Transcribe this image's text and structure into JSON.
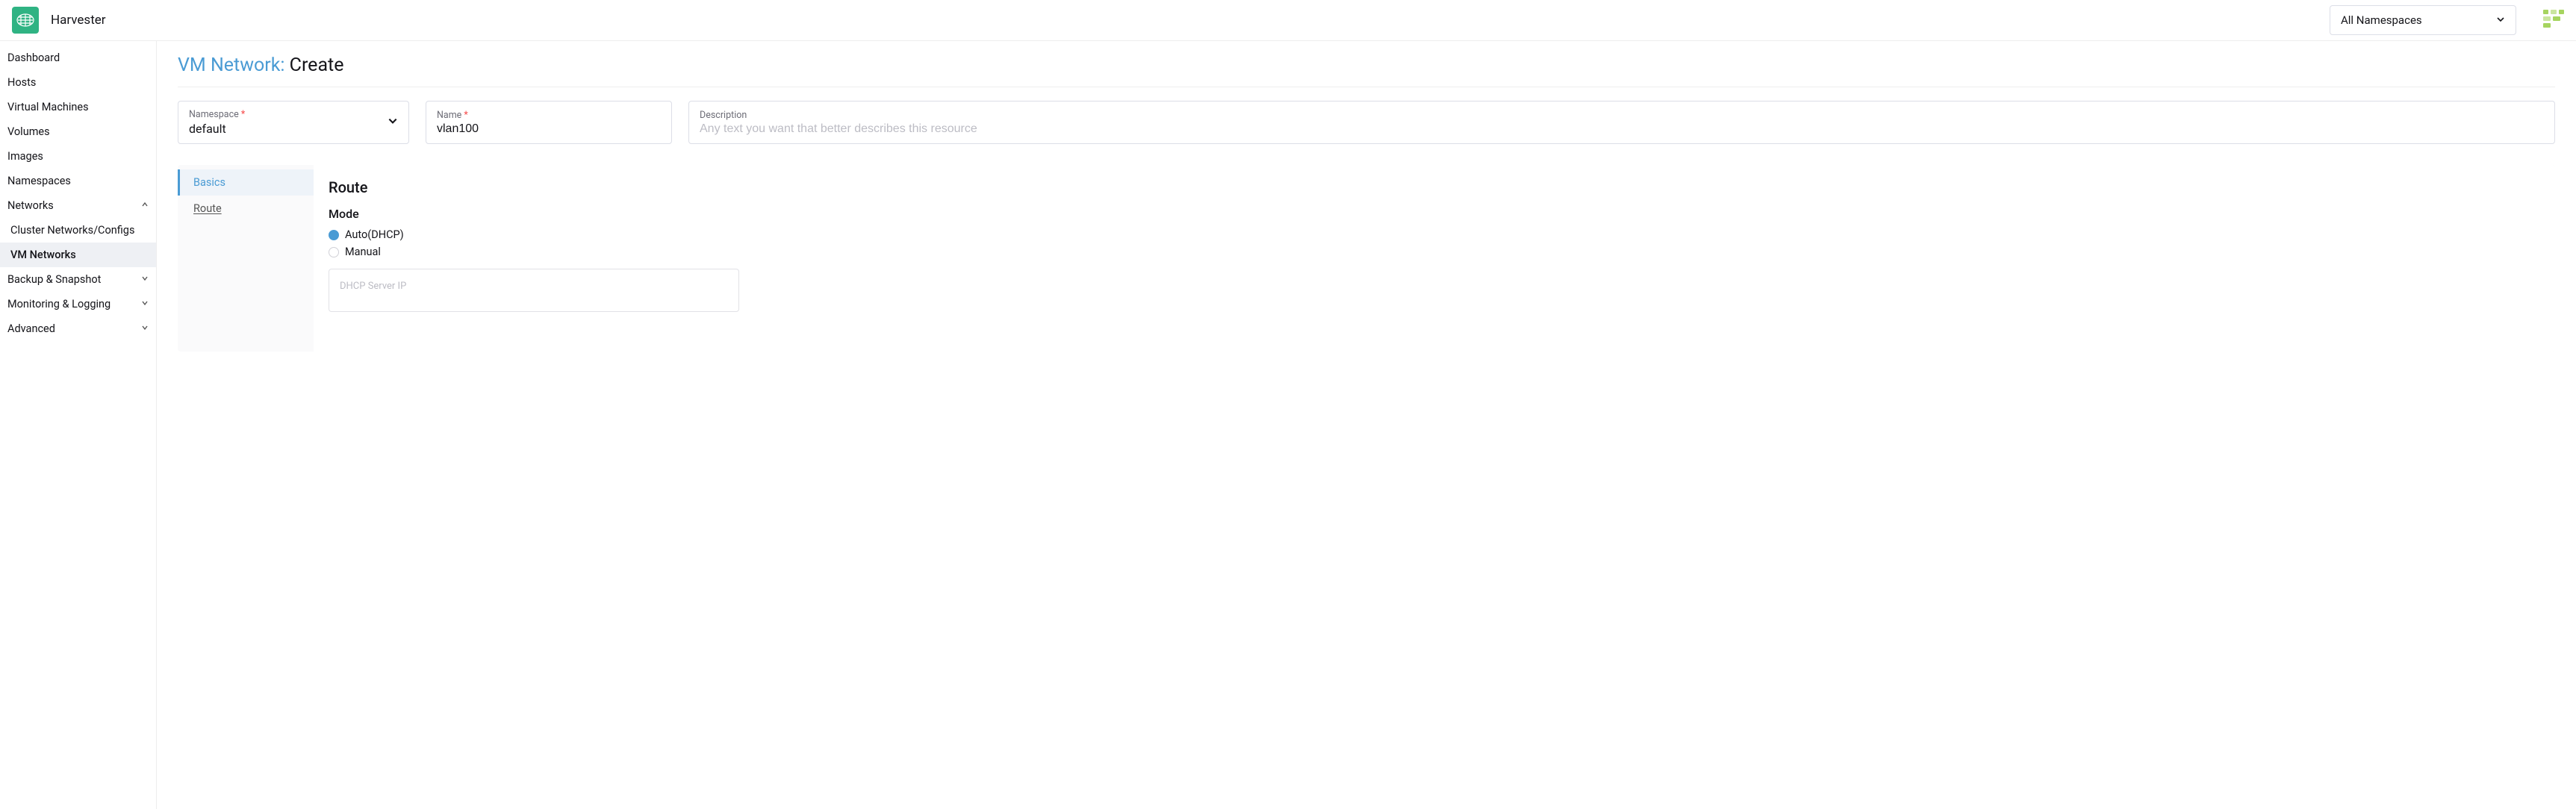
{
  "header": {
    "brand": "Harvester",
    "namespace_selector": "All Namespaces"
  },
  "sidebar": {
    "items": [
      {
        "label": "Dashboard"
      },
      {
        "label": "Hosts"
      },
      {
        "label": "Virtual Machines"
      },
      {
        "label": "Volumes"
      },
      {
        "label": "Images"
      },
      {
        "label": "Namespaces"
      },
      {
        "label": "Networks",
        "expandable": true,
        "expanded": true,
        "children": [
          {
            "label": "Cluster Networks/Configs"
          },
          {
            "label": "VM Networks",
            "active": true
          }
        ]
      },
      {
        "label": "Backup & Snapshot",
        "expandable": true,
        "expanded": false
      },
      {
        "label": "Monitoring & Logging",
        "expandable": true,
        "expanded": false
      },
      {
        "label": "Advanced",
        "expandable": true,
        "expanded": false
      }
    ]
  },
  "page": {
    "title_type": "VM Network:",
    "title_action": "Create"
  },
  "form": {
    "namespace": {
      "label": "Namespace",
      "required": true,
      "value": "default"
    },
    "name": {
      "label": "Name",
      "required": true,
      "value": "vlan100"
    },
    "description": {
      "label": "Description",
      "placeholder": "Any text you want that better describes this resource",
      "value": ""
    }
  },
  "tabs": {
    "items": [
      "Basics",
      "Route"
    ],
    "active": "Basics"
  },
  "route": {
    "section_title": "Route",
    "mode_label": "Mode",
    "options": {
      "auto": "Auto(DHCP)",
      "manual": "Manual"
    },
    "selected": "auto",
    "dhcp_placeholder": "DHCP Server IP"
  }
}
